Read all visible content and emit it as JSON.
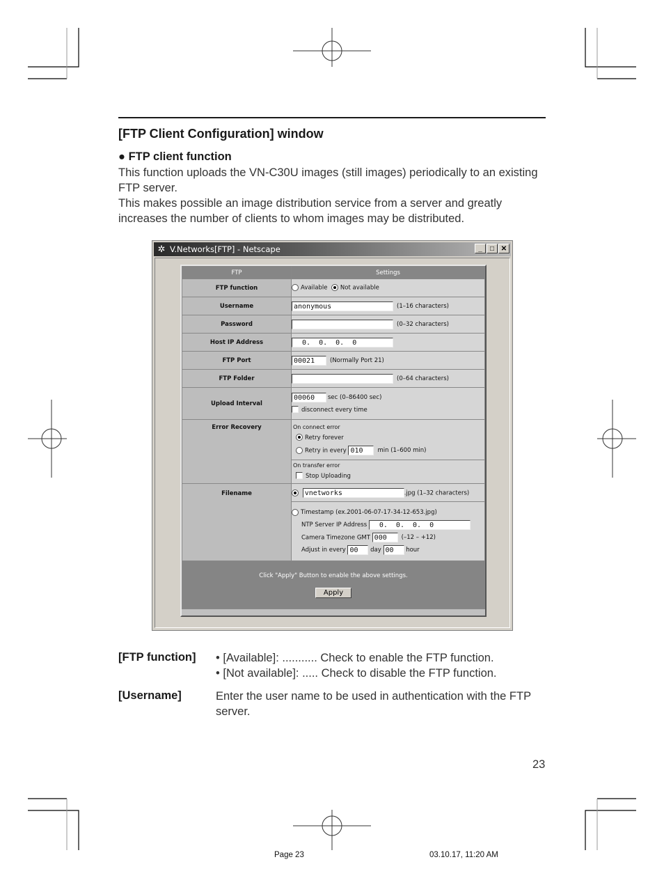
{
  "section": {
    "title": "[FTP Client Configuration] window",
    "subheading": "FTP client function",
    "bullet": "●",
    "paragraphs": [
      "This function uploads the VN-C30U images (still images) periodically to an existing FTP server.",
      "This makes possible an image distribution service from a server and greatly increases the number of clients to whom images may be distributed."
    ]
  },
  "window": {
    "title": "V.Networks[FTP] - Netscape",
    "app_icon": "netscape-icon",
    "controls": {
      "minimize": "_",
      "maximize": "□",
      "close": "✕"
    },
    "table_headers": [
      "FTP",
      "Settings"
    ],
    "rows": {
      "ftp_function": {
        "label": "FTP function",
        "options": [
          "Available",
          "Not available"
        ],
        "selected": "Not available"
      },
      "username": {
        "label": "Username",
        "value": "anonymous",
        "hint": "(1–16 characters)"
      },
      "password": {
        "label": "Password",
        "value": "",
        "hint": "(0–32 characters)"
      },
      "host_ip": {
        "label": "Host IP Address",
        "value": "0.  0.  0.  0"
      },
      "ftp_port": {
        "label": "FTP Port",
        "value": "00021",
        "hint": "(Normally Port 21)"
      },
      "ftp_folder": {
        "label": "FTP Folder",
        "value": "",
        "hint": "(0–64 characters)"
      },
      "upload_interval": {
        "label": "Upload Interval",
        "value": "00060",
        "hint": "sec (0–86400 sec)",
        "checkbox_label": "disconnect every time",
        "checked": false
      },
      "error_recovery": {
        "label": "Error Recovery",
        "connect_heading": "On connect error",
        "retry_forever": "Retry forever",
        "retry_every": "Retry in every",
        "retry_value": "010",
        "retry_hint": "min (1–600 min)",
        "selected": "Retry forever",
        "transfer_heading": "On transfer error",
        "stop_uploading": "Stop Uploading",
        "stop_checked": false
      },
      "filename": {
        "label": "Filename",
        "value": "vnetworks",
        "hint": ".jpg (1–32 characters)",
        "timestamp_label": "Timestamp (ex.2001-06-07-17-34-12-653.jpg)",
        "selected": "name",
        "ntp_label": "NTP Server IP Address",
        "ntp_value": "0.  0.  0.  0",
        "tz_label": "Camera Timezone GMT",
        "tz_value": "000",
        "tz_hint": "(–12 – +12)",
        "adjust_label": "Adjust in every",
        "adjust_day": "00",
        "day_label": "day",
        "adjust_hour": "00",
        "hour_label": "hour"
      }
    },
    "footer_note": "Click \"Apply\" Button to enable the above settings.",
    "apply_label": "Apply"
  },
  "descriptions": [
    {
      "term": "[FTP function]",
      "lines": [
        "• [Available]: ........... Check to enable the FTP function.",
        "• [Not available]: ..... Check to disable the FTP function."
      ]
    },
    {
      "term": "[Username]",
      "lines": [
        "Enter the user name to be used in authentication with the FTP server."
      ]
    }
  ],
  "page_number": "23",
  "footer": {
    "left": "Page 23",
    "right": "03.10.17, 11:20 AM"
  }
}
